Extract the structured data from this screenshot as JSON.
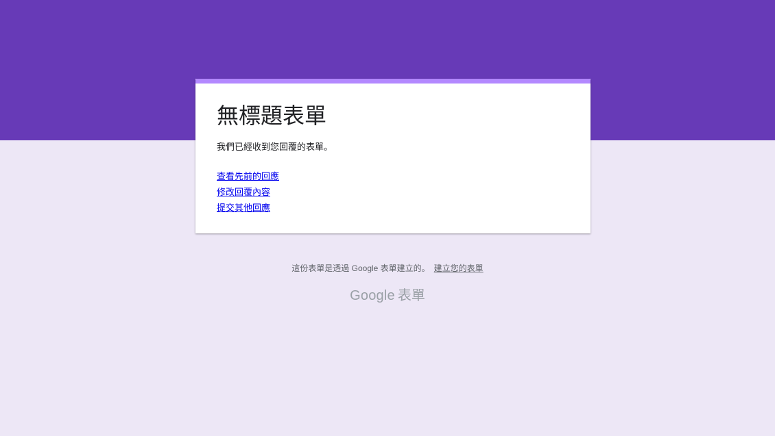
{
  "theme": {
    "header_color": "#673ab7",
    "accent_color": "#b388ff",
    "background_color": "#ede7f6",
    "link_color": "#0000ee"
  },
  "form": {
    "title": "無標題表單",
    "confirmation_message": "我們已經收到您回覆的表單。",
    "links": {
      "view_previous": "查看先前的回應",
      "edit_response": "修改回覆內容",
      "submit_another": "提交其他回應"
    }
  },
  "footer": {
    "created_with": "這份表單是透過 Google 表單建立的。",
    "create_your_own": "建立您的表單"
  },
  "brand": {
    "wordmark": "Google",
    "product": "表單"
  }
}
